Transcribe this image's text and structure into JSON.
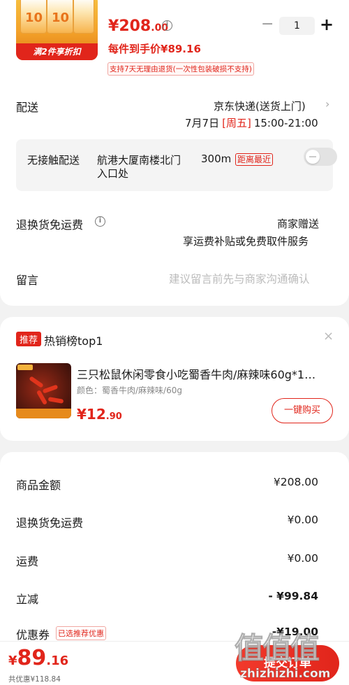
{
  "product": {
    "thumbnail_badge": "满2件享折扣",
    "pack_text": "10",
    "price_symbol": "¥",
    "price_int": "208",
    "price_dec": ".00",
    "info_icon": "i",
    "per_item_price": "每件到手价¥89.16",
    "return_policy": "支持7天无理由退货(一次性包装破损不支持)",
    "quantity": "1",
    "minus": "−",
    "plus": "+"
  },
  "delivery": {
    "label": "配送",
    "carrier": "京东快递(送货上门)",
    "date": "7月7日",
    "weekday": "[周五]",
    "time": "15:00-21:00",
    "chevron": "›"
  },
  "contactless": {
    "label": "无接触配送",
    "address_line1": "航港大厦南楼北门",
    "address_line2": "入口处",
    "distance": "300m",
    "distance_tag": "距离最近",
    "enabled": false
  },
  "return_shipping": {
    "label": "退换货免运费",
    "value_line1": "商家赠送",
    "value_line2": "享运费补贴或免费取件服务"
  },
  "message": {
    "label": "留言",
    "placeholder": "建议留言前先与商家沟通确认"
  },
  "recommendation": {
    "tag": "推荐",
    "title": "热销榜top1",
    "close": "×",
    "product_name": "三只松鼠休闲零食小吃蜀香牛肉/麻辣味60g*1…",
    "color": "颜色：蜀香牛肉/麻辣味/60g",
    "price_symbol": "¥",
    "price_int": "12",
    "price_dec": ".90",
    "buy_button": "一键购买"
  },
  "summary": {
    "rows": [
      {
        "label": "商品金额",
        "value": "¥208.00"
      },
      {
        "label": "退换货免运费",
        "value": "¥0.00"
      },
      {
        "label": "运费",
        "value": "¥0.00"
      },
      {
        "label": "立减",
        "value": "- ¥99.84"
      },
      {
        "label": "优惠券",
        "value": "-¥19.00",
        "tag": "已选推荐优惠"
      }
    ]
  },
  "bottom": {
    "total_symbol": "¥",
    "total_int": "89",
    "total_dec": ".16",
    "saved": "共优惠¥118.84",
    "submit": "提交订单"
  },
  "watermark": {
    "big": "值值值",
    "url": "zhizhizhi.com"
  },
  "colors": {
    "accent": "#e1251b",
    "background": "#f2f2f2"
  }
}
